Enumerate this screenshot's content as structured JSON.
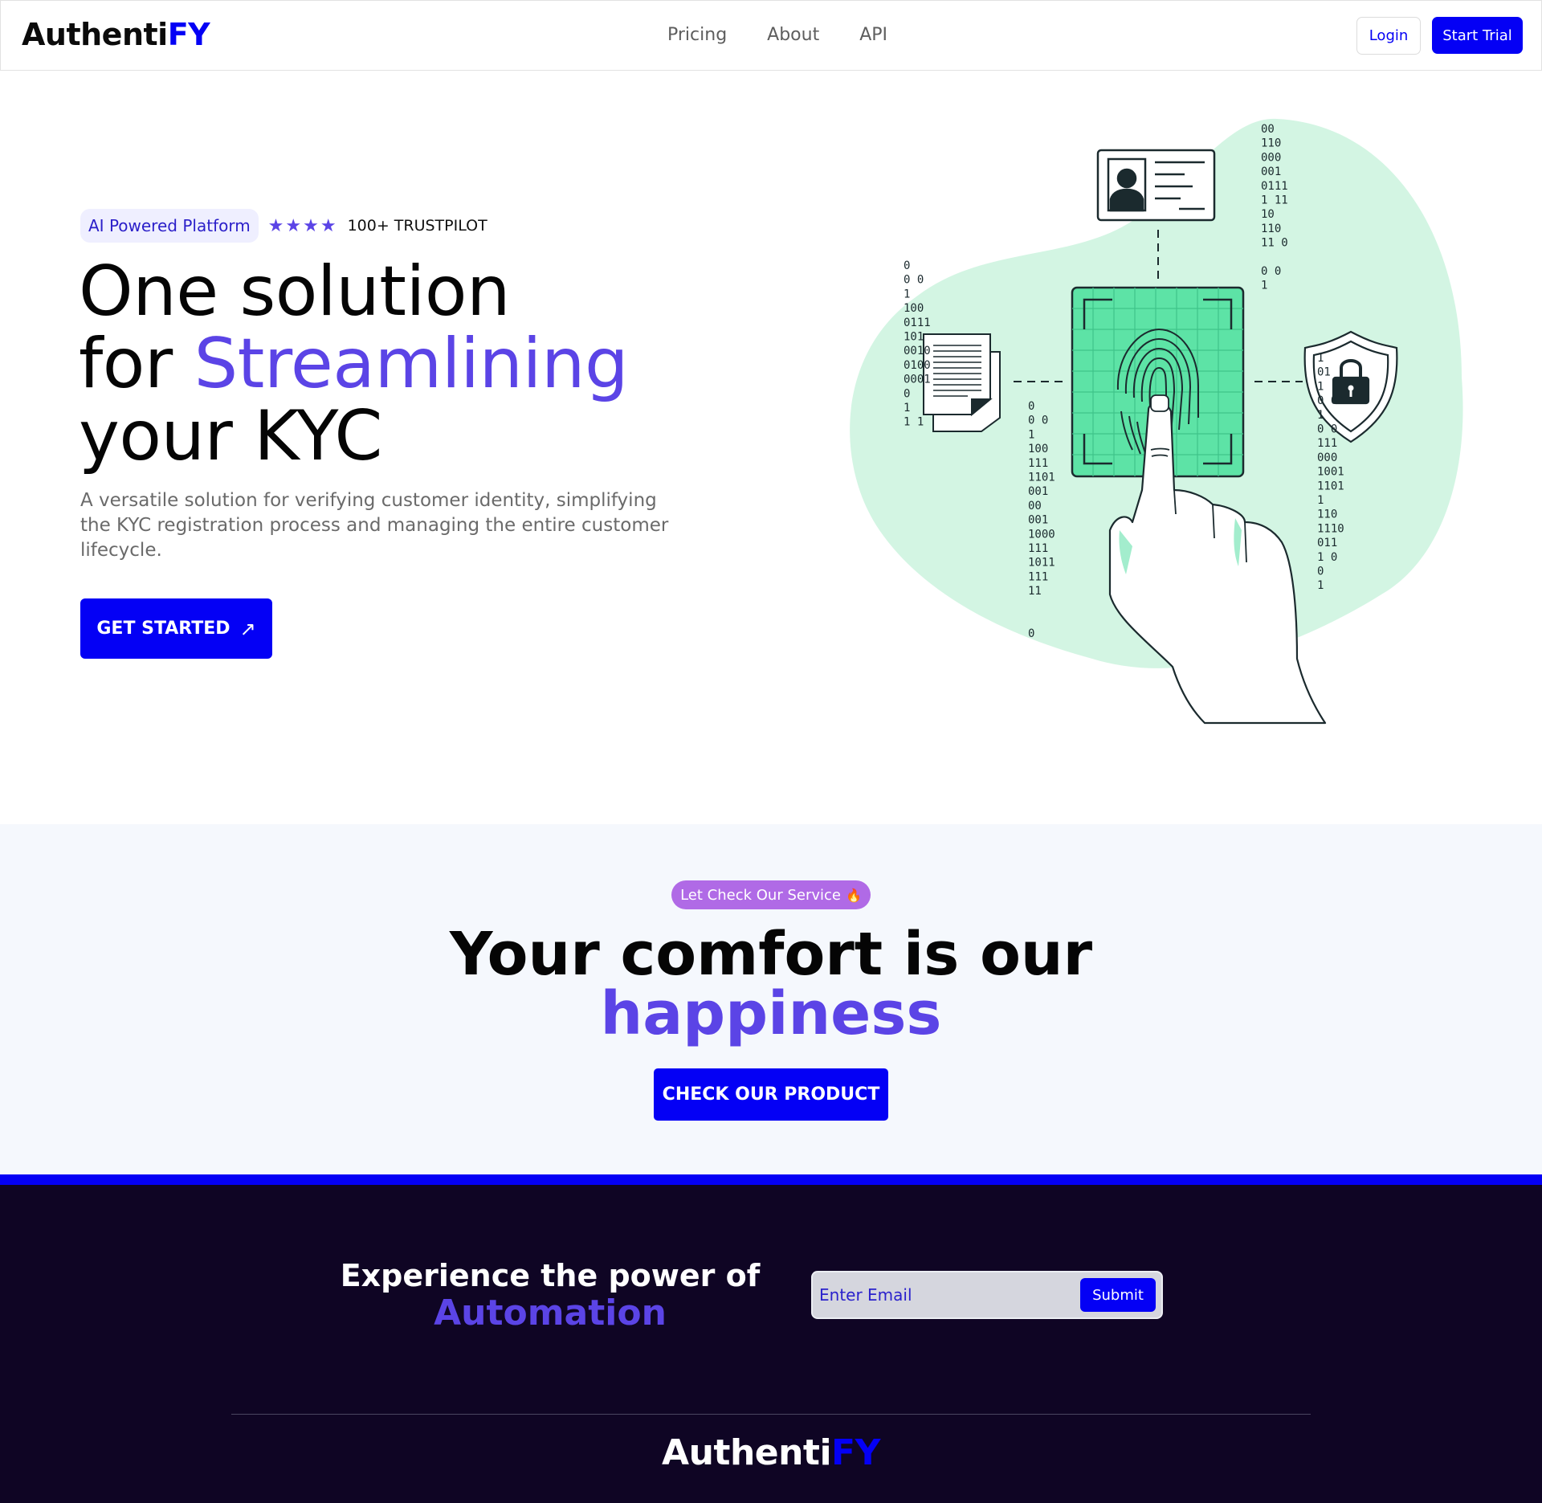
{
  "brand": {
    "name_part1": "Authenti",
    "name_part2": "FY",
    "accent": "#0400f5",
    "purple": "#5b44e6"
  },
  "nav": {
    "links": [
      {
        "label": "Pricing"
      },
      {
        "label": "About"
      },
      {
        "label": "API"
      }
    ],
    "login_label": "Login",
    "trial_label": "Start Trial"
  },
  "hero": {
    "badge": "AI Powered Platform",
    "stars": "★★★★",
    "rating_count": 4,
    "trust": "100+ TRUSTPILOT",
    "title_line1": "One solution",
    "title_line2_prefix": "for ",
    "title_line2_accent": "Streamlining",
    "title_line3": "your KYC",
    "description": "A versatile solution for verifying customer identity, simplifying the KYC registration process and managing the entire customer lifecycle.",
    "cta_label": "GET STARTED",
    "cta_arrow": "↗"
  },
  "illustration": {
    "icons": [
      "id-card-icon",
      "document-icon",
      "fingerprint-icon",
      "shield-lock-icon",
      "hand-icon"
    ],
    "binary_columns": [
      [
        "00",
        "110",
        "000",
        "001",
        "0111",
        "1 11",
        "10",
        "110",
        "11 0",
        "",
        "0  0",
        "1"
      ],
      [
        "0",
        "0 0",
        "1",
        "100",
        "0111",
        "101",
        "0010",
        "0100",
        "0001",
        "0",
        "1",
        "1 1"
      ],
      [
        "0",
        "0 0",
        "1",
        "100",
        "111",
        "1101",
        "001",
        "00",
        "001",
        "1000",
        "111",
        "1011",
        "111",
        "11",
        "",
        "",
        "0"
      ],
      [
        "1",
        "01",
        "1",
        "0 00",
        "1",
        "0 0",
        "111",
        "000",
        "1001",
        "1101",
        "1",
        "110",
        "1110",
        "011",
        "1 0",
        "0",
        "1"
      ]
    ],
    "blob_color": "#d3f5e3",
    "scanner_color": "#5de3a6",
    "line_color": "#1b2a2e"
  },
  "service": {
    "pill": "Let Check Our Service",
    "pill_icon": "flame-icon",
    "title_line1": "Your comfort is our",
    "title_line2": "happiness",
    "cta_label": "CHECK OUR PRODUCT"
  },
  "footer": {
    "cta_line1": "Experience the power of",
    "cta_line2": "Automation",
    "email_placeholder": "Enter Email",
    "submit_label": "Submit",
    "bg": "#0f0524"
  }
}
